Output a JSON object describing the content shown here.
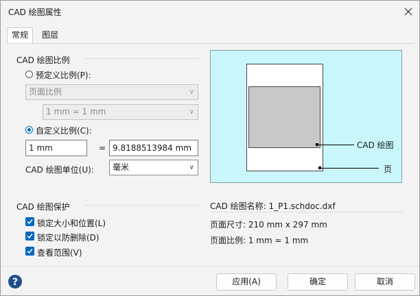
{
  "window": {
    "title": "CAD 绘图属性"
  },
  "tabs": [
    {
      "label": "常规",
      "active": true
    },
    {
      "label": "图层",
      "active": false
    }
  ],
  "scale": {
    "section_title": "CAD 绘图比例",
    "predefined": {
      "label": "预定义比例(P):",
      "selected": false
    },
    "page_scale_select": "页面比例",
    "mm_scale_select": "1 mm = 1 mm",
    "custom": {
      "label": "自定义比例(C):",
      "selected": true
    },
    "custom_left_value": "1 mm",
    "equals": "=",
    "custom_right_value": "9.8188513984 mm",
    "unit_label": "CAD 绘图单位(U):",
    "unit_value": "毫米"
  },
  "protection": {
    "section_title": "CAD 绘图保护",
    "items": [
      {
        "label": "锁定大小和位置(L)",
        "checked": true
      },
      {
        "label": "锁定以防删除(D)",
        "checked": true
      },
      {
        "label": "查看范围(V)",
        "checked": true
      }
    ]
  },
  "preview": {
    "drawing_label": "CAD 绘图",
    "page_label": "页",
    "bg_color": "#c8f6fb"
  },
  "info": {
    "name": "CAD 绘图名称:  1_P1.schdoc.dxf",
    "page_size": "页面尺寸:  210 mm x 297 mm",
    "page_scale": "页面比例:  1 mm = 1 mm"
  },
  "buttons": {
    "apply": "应用(A)",
    "ok": "确定",
    "cancel": "取消"
  },
  "icons": {
    "close": "close-icon",
    "help": "help-icon",
    "dropdown": "chevron-down-icon",
    "check": "checkmark-icon"
  },
  "colors": {
    "accent": "#0067c0",
    "help": "#1f4e8c"
  }
}
